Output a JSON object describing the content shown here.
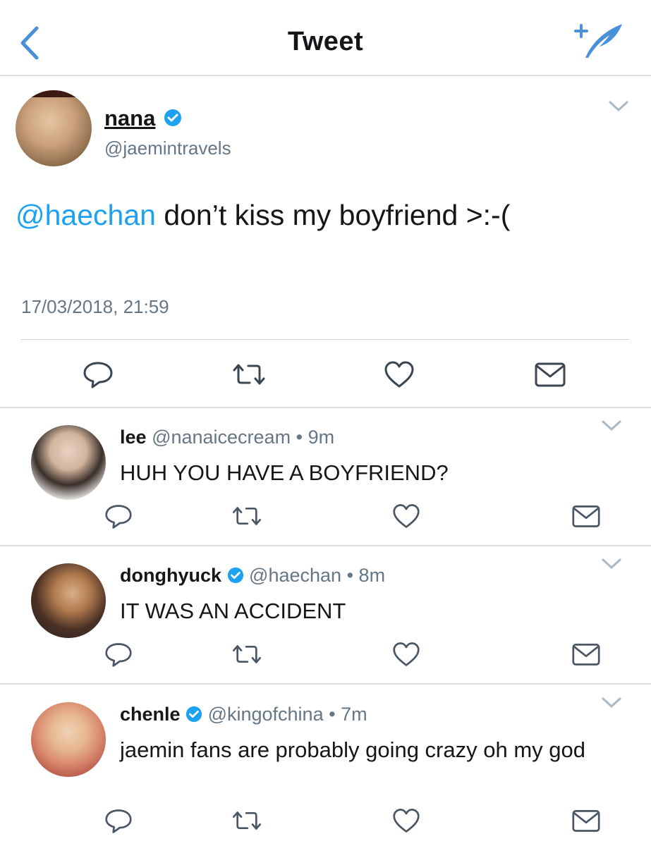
{
  "header": {
    "title": "Tweet"
  },
  "main_tweet": {
    "name": "nana",
    "handle": "@jaemintravels",
    "mention": "@haechan",
    "text": " don’t kiss my boyfriend >:-(",
    "timestamp": "17/03/2018, 21:59",
    "colors": {
      "link": "#1da1f2",
      "verified": "#1da1f2"
    }
  },
  "replies": [
    {
      "name": "lee",
      "verified": false,
      "handle": "@nanaicecream",
      "dot": "•",
      "time": "9m",
      "text": "HUH YOU HAVE A BOYFRIEND?"
    },
    {
      "name": "donghyuck",
      "verified": true,
      "handle": "@haechan",
      "dot": "•",
      "time": "8m",
      "text": "IT WAS AN ACCIDENT"
    },
    {
      "name": "chenle",
      "verified": true,
      "handle": "@kingofchina",
      "dot": "•",
      "time": "7m",
      "text": "jaemin fans are probably going crazy oh my god"
    }
  ],
  "icons": [
    "back-arrow-icon",
    "compose-tweet-icon",
    "chevron-down-icon",
    "verified-badge-icon",
    "reply-icon",
    "retweet-icon",
    "like-icon",
    "direct-message-icon"
  ]
}
